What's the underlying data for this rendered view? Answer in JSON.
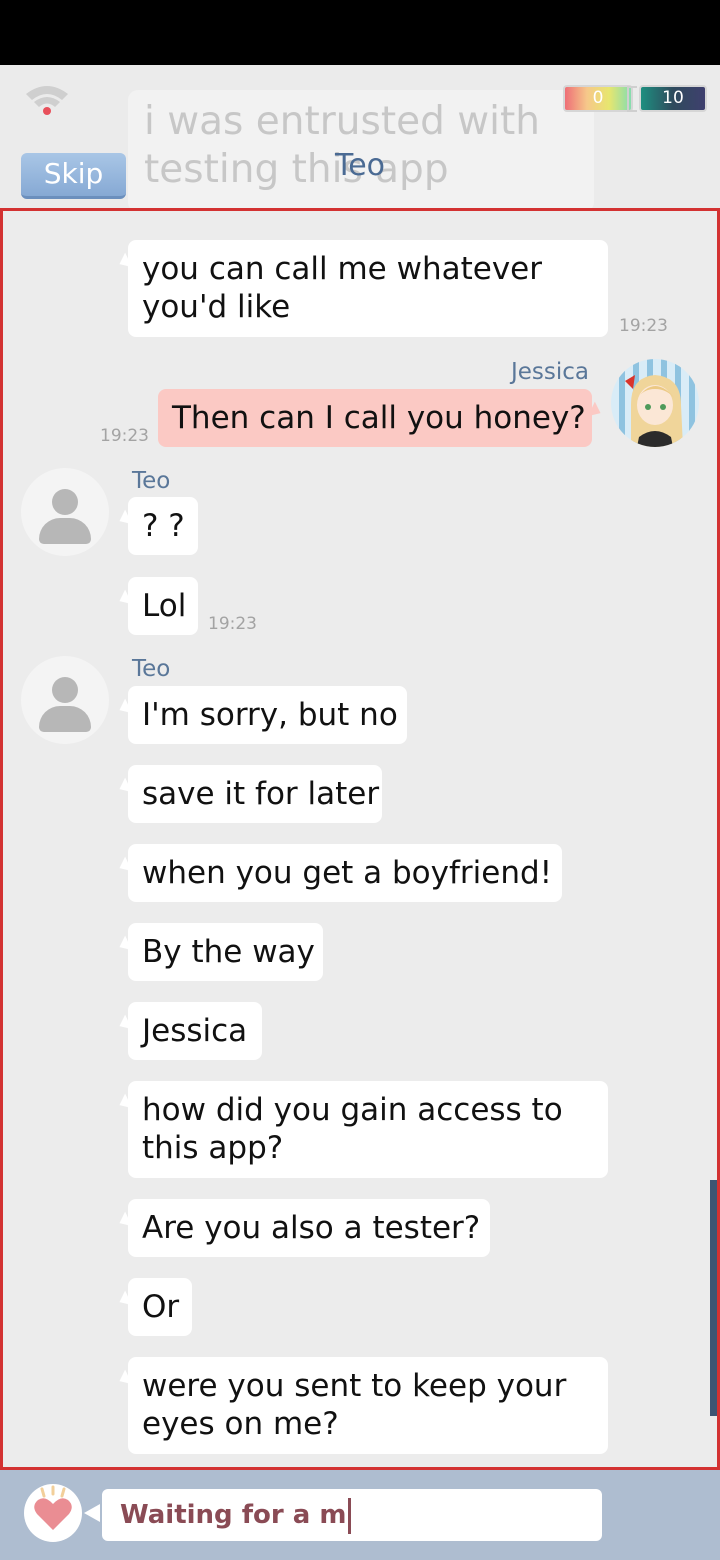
{
  "header": {
    "ghost_message": "i was entrusted with\ntesting this app",
    "skip_label": "Skip",
    "title": "Teo",
    "hearts_count": "0",
    "coins_count": "10"
  },
  "messages": [
    {
      "text": "you can call me whatever\nyou'd like",
      "time": "19:23"
    },
    {
      "sender": "Jessica",
      "text": "Then can I call you honey?",
      "time": "19:23"
    },
    {
      "sender": "Teo",
      "text": "? ?"
    },
    {
      "text": "Lol",
      "time": "19:23"
    },
    {
      "sender": "Teo",
      "text": "I'm sorry, but no"
    },
    {
      "text": "save it for later"
    },
    {
      "text": "when you get a boyfriend!"
    },
    {
      "text": "By the way"
    },
    {
      "text": "Jessica"
    },
    {
      "text": "how did you gain access to\nthis app?"
    },
    {
      "text": "Are you also a tester?"
    },
    {
      "text": "Or"
    },
    {
      "text": "were you sent to keep your\neyes on me?"
    }
  ],
  "input": {
    "value": "Waiting for a m"
  },
  "icons": {
    "wifi": "wifi-icon",
    "heart": "heart-icon",
    "avatar": "user-avatar-icon"
  },
  "colors": {
    "my_bubble": "#fbc9c4",
    "other_bubble": "#ffffff",
    "accent_border": "#d33232",
    "input_bar": "#aebdd0"
  }
}
